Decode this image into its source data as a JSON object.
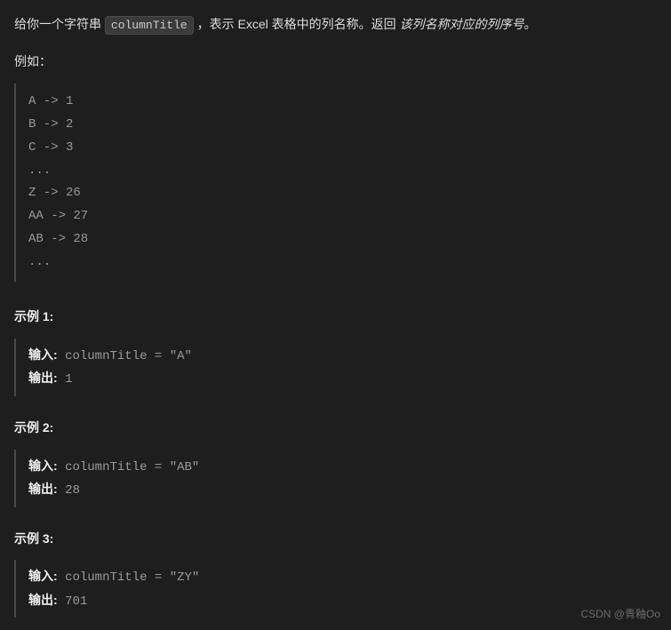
{
  "description": {
    "prefix": "给你一个字符串 ",
    "code": "columnTitle",
    "middle": " ，表示 Excel 表格中的列名称。返回 ",
    "italic": "该列名称对应的列序号",
    "suffix": "。"
  },
  "exampleLabel": "例如：",
  "mappingBlock": "A -> 1\nB -> 2\nC -> 3\n...\nZ -> 26\nAA -> 27\nAB -> 28 \n...",
  "examples": [
    {
      "title": "示例 1:",
      "inputLabel": "输入:",
      "inputValue": " columnTitle = \"A\"",
      "outputLabel": "输出:",
      "outputValue": " 1"
    },
    {
      "title": "示例 2:",
      "inputLabel": "输入:",
      "inputValue": " columnTitle = \"AB\"",
      "outputLabel": "输出:",
      "outputValue": " 28"
    },
    {
      "title": "示例 3:",
      "inputLabel": "输入:",
      "inputValue": " columnTitle = \"ZY\"",
      "outputLabel": "输出:",
      "outputValue": " 701"
    }
  ],
  "watermark": "CSDN @青釉Oo"
}
